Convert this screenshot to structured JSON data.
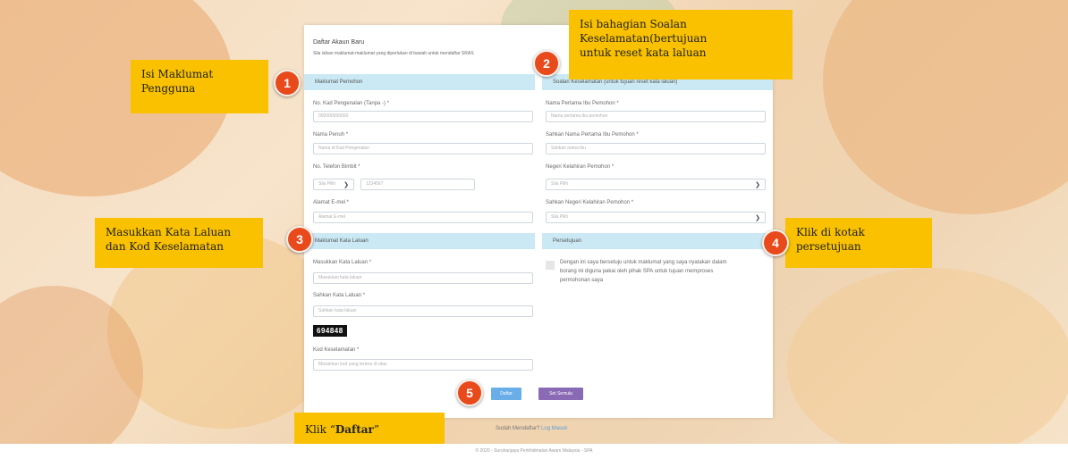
{
  "form": {
    "title": "Daftar Akaun Baru",
    "subtitle": "Sila isikan maklumat-maklumat yang diperlukan di bawah untuk mendaftar SRAS",
    "section_applicant": "Maklumat Pemohon",
    "section_security_question": "Soalan Keselamatan (untuk tujuan reset kata laluan)",
    "section_password": "Maklumat Kata Laluan",
    "section_consent": "Persetujuan",
    "ic_label": "No. Kad Pengenalan (Tanpa -) *",
    "ic_placeholder": "000000000000",
    "name_label": "Nama Penuh *",
    "name_placeholder": "Nama di Kad Pengenalan",
    "phone_label": "No. Telefon Bimbit *",
    "phone_prefix": "Sila Pilih",
    "phone_placeholder": "1234567",
    "email_label": "Alamat E-mel *",
    "email_placeholder": "Alamat E-mel",
    "password_label": "Masukkan Kata Laluan *",
    "password_placeholder": "Masukkan kata laluan",
    "confirm_password_label": "Sahkan Kata Laluan *",
    "confirm_password_placeholder": "Sahkan kata laluan",
    "captcha": "694848",
    "security_code_label": "Kod Keselamatan *",
    "security_code_placeholder": "Masukkan kod yang tertera di atas",
    "mother_name_label": "Nama Pertama Ibu Pemohon *",
    "mother_name_placeholder": "Nama pertama ibu pemohon",
    "confirm_mother_name_label": "Sahkan Nama Pertama Ibu Pemohon *",
    "confirm_mother_name_placeholder": "Sahkan nama ibu",
    "birth_state_label": "Negeri Kelahiran Pemohon *",
    "birth_state_value": "Sila Pilih",
    "confirm_birth_state_label": "Sahkan Negeri Kelahiran Pemohon *",
    "confirm_birth_state_value": "Sila Pilih",
    "consent_text_1": "Dengan ini saya bersetuju untuk maklumat yang saya nyatakan dalam",
    "consent_text_2": "borang ini diguna pakai oleh pihak SPA untuk tujuan memproses",
    "consent_text_3": "permohonan saya",
    "register_button": "Daftar",
    "reset_button": "Set Semula",
    "already_registered": "Sudah Mendaftar?",
    "login_link": "Log Masuk"
  },
  "callouts": {
    "c1_line1": "Isi Maklumat",
    "c1_line2": "Pengguna",
    "c2_line1": "Isi bahagian Soalan",
    "c2_line2": "Keselamatan(bertujuan",
    "c2_line3": "untuk reset kata laluan",
    "c3_line1": "Masukkan Kata Laluan",
    "c3_line2": "dan Kod Keselamatan",
    "c4_line1": "Klik di kotak",
    "c4_line2": "persetujuan",
    "c5_prefix": "Klik “",
    "c5_bold": "Daftar",
    "c5_suffix": "”"
  },
  "badges": [
    "1",
    "2",
    "3",
    "4",
    "5"
  ],
  "footer": "© 2020 - Suruhanjaya Perkhidmatan Awam Malaysia - SPA",
  "colors": {
    "callout": "#f9c100",
    "badge": "#e84a1c",
    "section_header": "#cbe9f4",
    "register_button": "#6aaee8",
    "reset_button": "#8a6ab4"
  }
}
